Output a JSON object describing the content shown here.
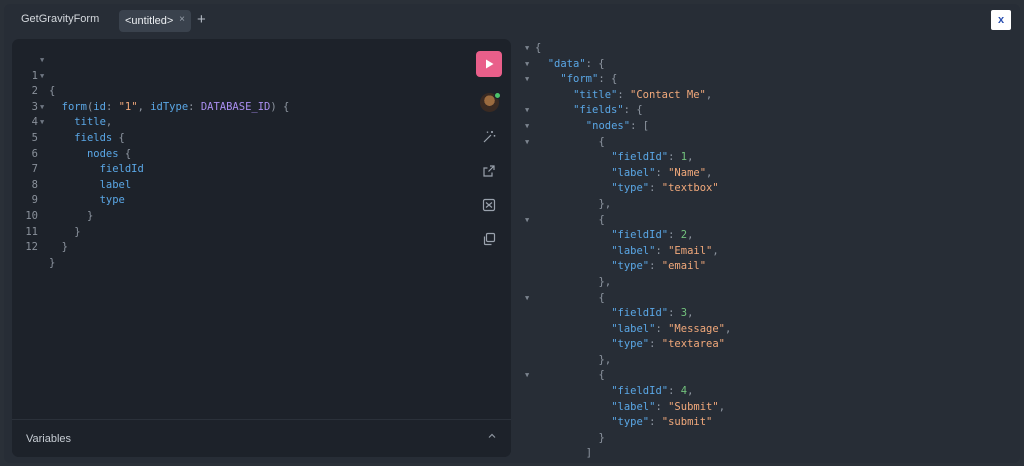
{
  "tabs": {
    "title": "GetGravityForm",
    "active_tab": "<untitled>",
    "close_glyph": "×",
    "add_glyph": "+",
    "close_window": "x"
  },
  "editor": {
    "lines": [
      {
        "n": "1",
        "fold": true
      },
      {
        "n": "2",
        "fold": true
      },
      {
        "n": "3",
        "fold": false
      },
      {
        "n": "4",
        "fold": true
      },
      {
        "n": "5",
        "fold": true
      },
      {
        "n": "6",
        "fold": false
      },
      {
        "n": "7",
        "fold": false
      },
      {
        "n": "8",
        "fold": false
      },
      {
        "n": "9",
        "fold": false
      },
      {
        "n": "10",
        "fold": false
      },
      {
        "n": "11",
        "fold": false
      },
      {
        "n": "12",
        "fold": false
      }
    ],
    "query": {
      "open": "{",
      "field_form": "form",
      "arg_id": "id",
      "arg_id_value": "\"1\"",
      "arg_idtype": "idType",
      "arg_idtype_value": "DATABASE_ID",
      "field_title": "title",
      "field_fields": "fields",
      "field_nodes": "nodes",
      "field_fieldid": "fieldId",
      "field_label": "label",
      "field_type": "type",
      "close": "}"
    },
    "toolbar": {
      "run": "run-icon",
      "avatar": "user-avatar",
      "prettify": "magic-wand-icon",
      "share": "external-link-icon",
      "merge": "merge-fragments-icon",
      "copy": "copy-icon"
    }
  },
  "variables": {
    "label": "Variables",
    "chevron": "^"
  },
  "result": {
    "data_key": "\"data\"",
    "form_key": "\"form\"",
    "title_key": "\"title\"",
    "title_value": "\"Contact Me\"",
    "fields_key": "\"fields\"",
    "nodes_key": "\"nodes\"",
    "fieldid_key": "\"fieldId\"",
    "label_key": "\"label\"",
    "type_key": "\"type\"",
    "nodes": [
      {
        "fieldId": "1",
        "label": "\"Name\"",
        "type": "\"textbox\""
      },
      {
        "fieldId": "2",
        "label": "\"Email\"",
        "type": "\"email\""
      },
      {
        "fieldId": "3",
        "label": "\"Message\"",
        "type": "\"textarea\""
      },
      {
        "fieldId": "4",
        "label": "\"Submit\"",
        "type": "\"submit\""
      }
    ]
  },
  "colors": {
    "accent_run": "#e95f8a",
    "key": "#5aa7e6",
    "string": "#f2a97b",
    "number": "#73c37d",
    "enum": "#a98ef0"
  }
}
